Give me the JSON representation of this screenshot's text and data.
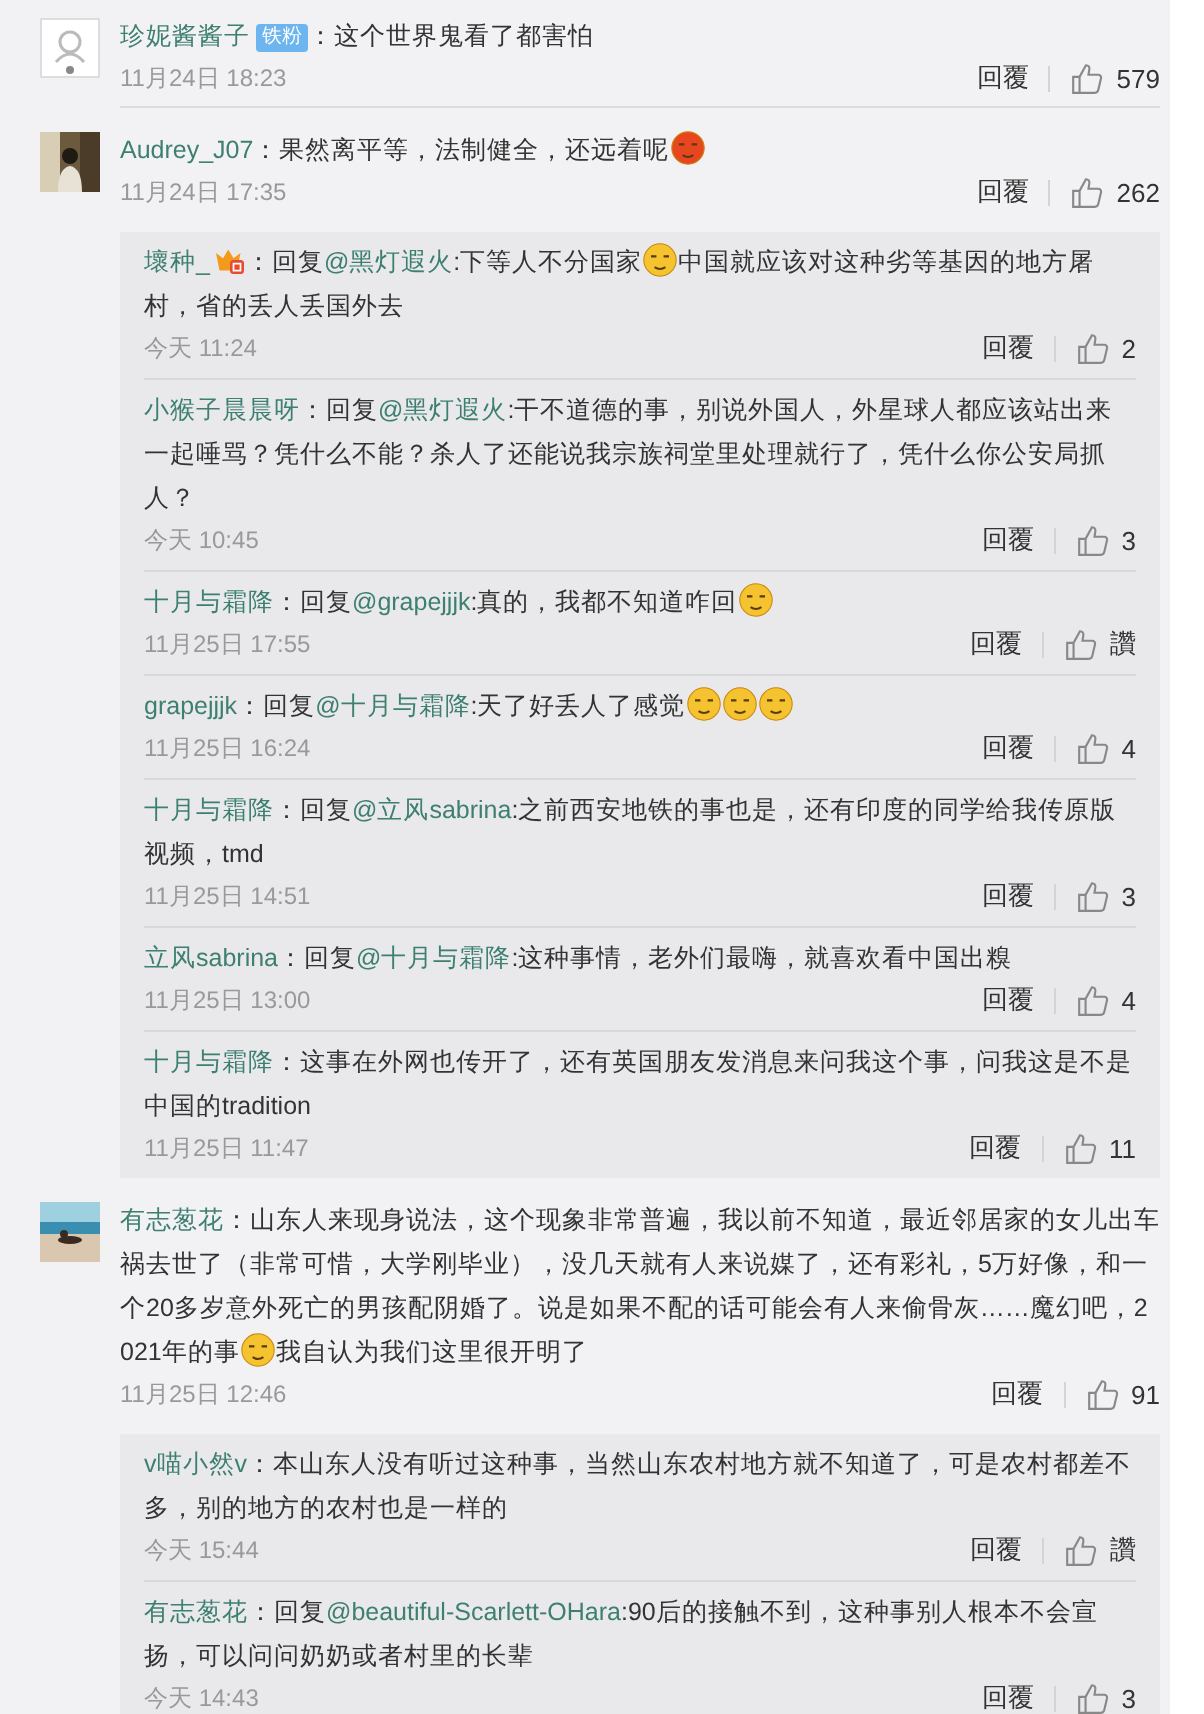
{
  "comments": [
    {
      "avatar": {
        "kind": "icon"
      },
      "user": "珍妮酱酱子",
      "badge": "铁粉",
      "parts": [
        {
          "kind": "text",
          "text": "：这个世界鬼看了都害怕"
        }
      ],
      "time": "11月24日 18:23",
      "reply_label": "回覆",
      "likes": "579"
    },
    {
      "avatar": {
        "kind": "picture"
      },
      "user": "Audrey_J07",
      "parts": [
        {
          "kind": "text",
          "text": "：果然离平等，法制健全，还远着呢"
        },
        {
          "kind": "emoji",
          "color": "#e8461e"
        }
      ],
      "time": "11月24日 17:35",
      "reply_label": "回覆",
      "likes": "262",
      "replies": [
        {
          "user": "壞种_",
          "vip": true,
          "parts": [
            {
              "kind": "text",
              "text": "：回复"
            },
            {
              "kind": "mention",
              "text": "@黑灯遐火"
            },
            {
              "kind": "text",
              "text": ":下等人不分国家"
            },
            {
              "kind": "emoji",
              "color": "#f5c230"
            },
            {
              "kind": "text",
              "text": "中国就应该对这种劣等基因的地方屠村，省的丢人丢国外去"
            }
          ],
          "time": "今天 11:24",
          "reply_label": "回覆",
          "likes": "2"
        },
        {
          "user": "小猴子晨晨呀",
          "vip": false,
          "parts": [
            {
              "kind": "text",
              "text": "：回复"
            },
            {
              "kind": "mention",
              "text": "@黑灯遐火"
            },
            {
              "kind": "text",
              "text": ":干不道德的事，别说外国人，外星球人都应该站出来一起唾骂？凭什么不能？杀人了还能说我宗族祠堂里处理就行了，凭什么你公安局抓人？"
            }
          ],
          "time": "今天 10:45",
          "reply_label": "回覆",
          "likes": "3"
        },
        {
          "user": "十月与霜降",
          "vip": false,
          "parts": [
            {
              "kind": "text",
              "text": "：回复"
            },
            {
              "kind": "mention",
              "text": "@grapejjjk"
            },
            {
              "kind": "text",
              "text": ":真的，我都不知道咋回"
            },
            {
              "kind": "emoji",
              "color": "#f5c230"
            }
          ],
          "time": "11月25日 17:55",
          "reply_label": "回覆",
          "likes": "讚"
        },
        {
          "user": "grapejjjk",
          "vip": false,
          "parts": [
            {
              "kind": "text",
              "text": "：回复"
            },
            {
              "kind": "mention",
              "text": "@十月与霜降"
            },
            {
              "kind": "text",
              "text": ":天了好丢人了感觉"
            },
            {
              "kind": "emoji",
              "color": "#f5c230"
            },
            {
              "kind": "emoji",
              "color": "#f5c230"
            },
            {
              "kind": "emoji",
              "color": "#f5c230"
            }
          ],
          "time": "11月25日 16:24",
          "reply_label": "回覆",
          "likes": "4"
        },
        {
          "user": "十月与霜降",
          "vip": false,
          "parts": [
            {
              "kind": "text",
              "text": "：回复"
            },
            {
              "kind": "mention",
              "text": "@立风sabrina"
            },
            {
              "kind": "text",
              "text": ":之前西安地铁的事也是，还有印度的同学给我传原版视频，tmd"
            }
          ],
          "time": "11月25日 14:51",
          "reply_label": "回覆",
          "likes": "3"
        },
        {
          "user": "立风sabrina",
          "vip": false,
          "parts": [
            {
              "kind": "text",
              "text": "：回复"
            },
            {
              "kind": "mention",
              "text": "@十月与霜降"
            },
            {
              "kind": "text",
              "text": ":这种事情，老外们最嗨，就喜欢看中国出糗"
            }
          ],
          "time": "11月25日 13:00",
          "reply_label": "回覆",
          "likes": "4"
        },
        {
          "user": "十月与霜降",
          "vip": false,
          "parts": [
            {
              "kind": "text",
              "text": "：这事在外网也传开了，还有英国朋友发消息来问我这个事，问我这是不是中国的tradition"
            }
          ],
          "time": "11月25日 11:47",
          "reply_label": "回覆",
          "likes": "11"
        }
      ]
    },
    {
      "avatar": {
        "kind": "picture"
      },
      "user": "有志葱花",
      "parts": [
        {
          "kind": "text",
          "text": "：山东人来现身说法，这个现象非常普遍，我以前不知道，最近邻居家的女儿出车祸去世了（非常可惜，大学刚毕业），没几天就有人来说媒了，还有彩礼，5万好像，和一个20多岁意外死亡的男孩配阴婚了。说是如果不配的话可能会有人来偷骨灰……魔幻吧，2021年的事"
        },
        {
          "kind": "emoji",
          "color": "#f5c230"
        },
        {
          "kind": "text",
          "text": "我自认为我们这里很开明了"
        }
      ],
      "time": "11月25日 12:46",
      "reply_label": "回覆",
      "likes": "91",
      "replies": [
        {
          "user": "v喵小然v",
          "vip": false,
          "parts": [
            {
              "kind": "text",
              "text": "：本山东人没有听过这种事，当然山东农村地方就不知道了，可是农村都差不多，别的地方的农村也是一样的"
            }
          ],
          "time": "今天 15:44",
          "reply_label": "回覆",
          "likes": "讚"
        },
        {
          "user": "有志葱花",
          "vip": false,
          "parts": [
            {
              "kind": "text",
              "text": "：回复"
            },
            {
              "kind": "mention",
              "text": "@beautiful-Scarlett-OHara"
            },
            {
              "kind": "text",
              "text": ":90后的接触不到，这种事别人根本不会宣扬，可以问问奶奶或者村里的长辈"
            }
          ],
          "time": "今天 14:43",
          "reply_label": "回覆",
          "likes": "3"
        }
      ]
    }
  ]
}
